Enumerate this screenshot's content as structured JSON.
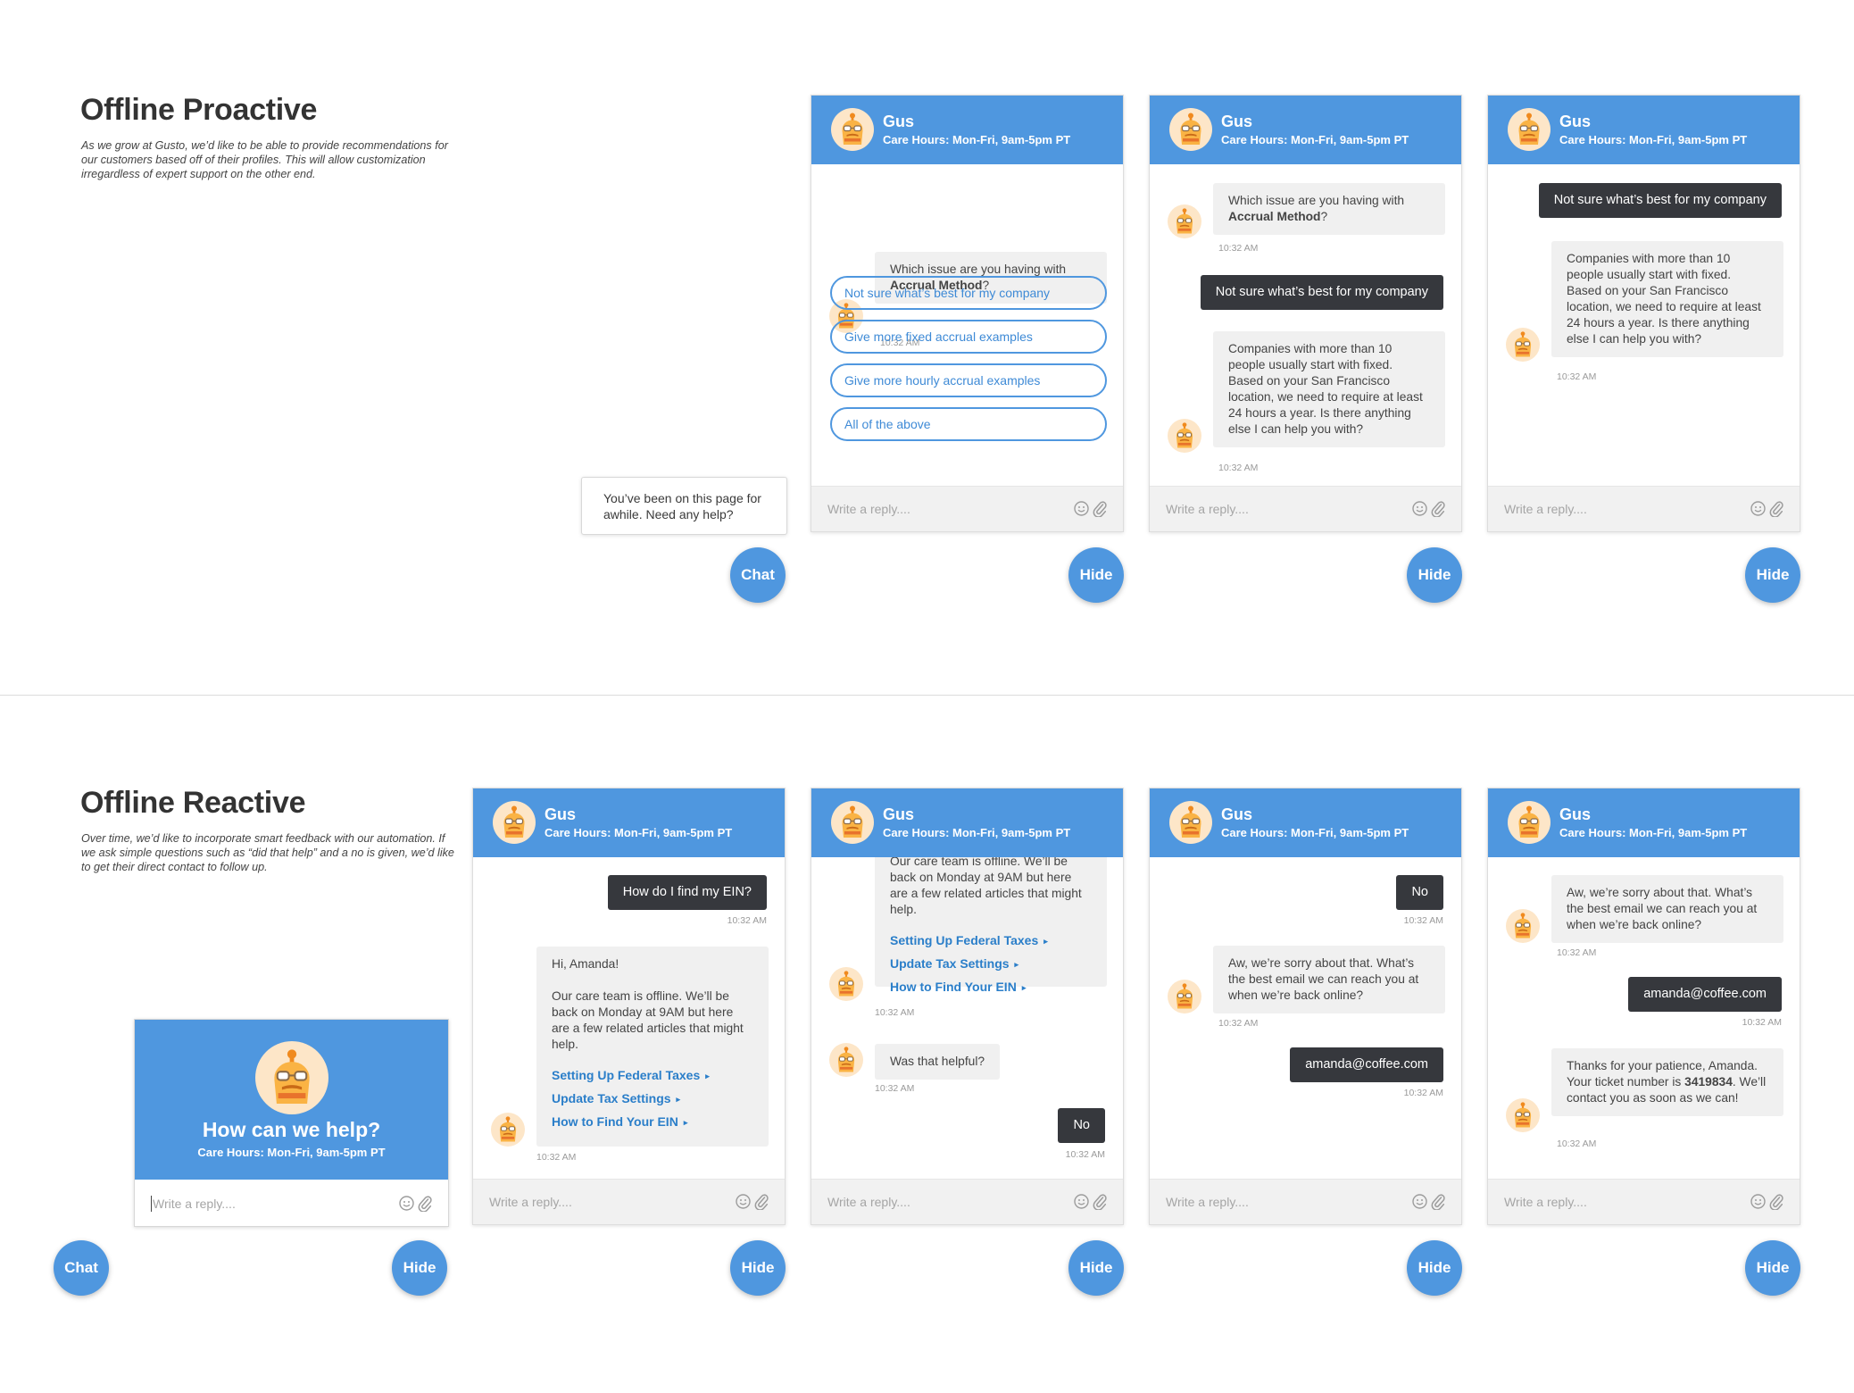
{
  "proactive": {
    "title": "Offline Proactive",
    "description": "As we grow at Gusto, we’d like to be able to provide recommendations for our customers based off of their profiles. This will allow customization irregardless of expert support on the other end."
  },
  "reactive": {
    "title": "Offline Reactive",
    "description": "Over time, we’d like to incorporate smart feedback with our automation. If we ask simple questions such as “did that help” and a no is given, we’d like to get their direct contact to follow up."
  },
  "agent": {
    "name": "Gus",
    "hours": "Care Hours: Mon-Fri, 9am-5pm PT"
  },
  "composer": {
    "placeholder": "Write a reply...."
  },
  "buttons": {
    "chat": "Chat",
    "hide": "Hide"
  },
  "toast": {
    "text": "You’ve been on this page for awhile. Need any help?"
  },
  "welcome": {
    "title": "How can we help?",
    "hours": "Care Hours: Mon-Fri, 9am-5pm PT"
  },
  "time": "10:32 AM",
  "p1": {
    "question_pre": "Which issue are you having with ",
    "question_bold": "Accrual Method",
    "question_post": "?",
    "options": [
      "Not sure what’s best for my company",
      "Give more fixed accrual examples",
      "Give more hourly accrual examples",
      "All of the above"
    ]
  },
  "p2": {
    "user_reply": "Not sure what’s best for my company",
    "answer": "Companies with more than 10 people usually start with fixed. Based on your San Francisco location, we need to require at least 24 hours a year. Is there anything else I can help you with?"
  },
  "r1": {
    "user_question": "How do I find my EIN?",
    "greeting": "Hi, Amanda!",
    "offline_msg": "Our care team is offline. We’ll be back on Monday at 9AM but here are a few related articles that might help.",
    "offline_cut": "Our care team is offline. We’ll be",
    "offline_tail": "back on Monday at 9AM but here are a few related articles that might help.",
    "links": [
      "Setting Up Federal Taxes",
      "Update Tax Settings",
      "How to Find Your EIN"
    ]
  },
  "r2": {
    "helpful_q": "Was that helpful?",
    "no": "No"
  },
  "r3": {
    "sorry": "Aw, we’re sorry about that. What’s the best email we can reach you at when we’re back online?",
    "email": "amanda@coffee.com"
  },
  "r4": {
    "thanks_pre": "Thanks for your patience, Amanda. Your ticket number is ",
    "ticket": "3419834",
    "thanks_post": ". We’ll contact you as soon as we can!"
  },
  "colors": {
    "brand_blue": "#4f97df",
    "user_bubble": "#36383d",
    "bot_bubble": "#f0f0f0",
    "link": "#2a7ec9"
  },
  "icons": [
    "gus-avatar-icon",
    "smile-icon",
    "paperclip-icon",
    "caret-right-icon"
  ]
}
